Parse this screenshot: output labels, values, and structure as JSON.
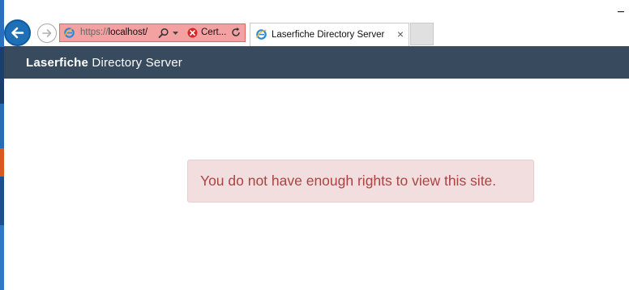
{
  "browser": {
    "address_bar": {
      "url_protocol": "https://",
      "url_host": "localhost/",
      "certificate_label": "Cert..."
    },
    "tab": {
      "title": "Laserfiche Directory Server",
      "close_glyph": "×"
    },
    "icons": {
      "back": "back-arrow-icon",
      "forward": "forward-arrow-icon",
      "site": "ie-icon",
      "search": "search-icon",
      "dropdown": "chevron-down-icon",
      "certificate_error": "certificate-error-icon",
      "refresh": "refresh-icon"
    },
    "colors": {
      "address_bar_error": "#f3a1a1",
      "back_button": "#1d6fb8"
    }
  },
  "app": {
    "header": {
      "brand_bold": "Laserfiche",
      "brand_rest": " Directory Server",
      "background": "#374a5e"
    },
    "alert": {
      "message": "You do not have enough rights to view this site.",
      "background": "#f2dede",
      "text_color": "#a94442"
    }
  }
}
